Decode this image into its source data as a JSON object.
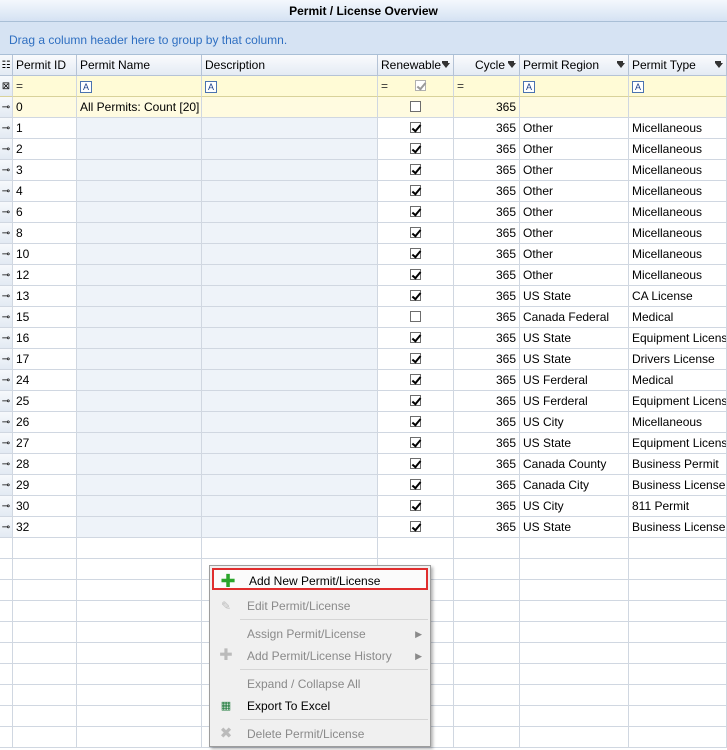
{
  "title": "Permit / License Overview",
  "group_hint": "Drag a column header here to group by that column.",
  "columns": {
    "id": "Permit ID",
    "name": "Permit Name",
    "desc": "Description",
    "renew": "Renewable",
    "cycle": "Cycle",
    "region": "Permit Region",
    "type": "Permit Type"
  },
  "filter": {
    "eq": "=",
    "text_icon": "A"
  },
  "group_row": {
    "id": "0",
    "name": "All Permits: Count [20]",
    "cycle": "365"
  },
  "rows": [
    {
      "id": "1",
      "cycle": "365",
      "region": "Other",
      "type": "Micellaneous",
      "renewable": true
    },
    {
      "id": "2",
      "cycle": "365",
      "region": "Other",
      "type": "Micellaneous",
      "renewable": true
    },
    {
      "id": "3",
      "cycle": "365",
      "region": "Other",
      "type": "Micellaneous",
      "renewable": true
    },
    {
      "id": "4",
      "cycle": "365",
      "region": "Other",
      "type": "Micellaneous",
      "renewable": true
    },
    {
      "id": "6",
      "cycle": "365",
      "region": "Other",
      "type": "Micellaneous",
      "renewable": true
    },
    {
      "id": "8",
      "cycle": "365",
      "region": "Other",
      "type": "Micellaneous",
      "renewable": true
    },
    {
      "id": "10",
      "cycle": "365",
      "region": "Other",
      "type": "Micellaneous",
      "renewable": true
    },
    {
      "id": "12",
      "cycle": "365",
      "region": "Other",
      "type": "Micellaneous",
      "renewable": true
    },
    {
      "id": "13",
      "cycle": "365",
      "region": "US State",
      "type": "CA License",
      "renewable": true
    },
    {
      "id": "15",
      "cycle": "365",
      "region": "Canada Federal",
      "type": "Medical",
      "renewable": false
    },
    {
      "id": "16",
      "cycle": "365",
      "region": "US State",
      "type": "Equipment Licens",
      "renewable": true
    },
    {
      "id": "17",
      "cycle": "365",
      "region": "US State",
      "type": "Drivers License",
      "renewable": true
    },
    {
      "id": "24",
      "cycle": "365",
      "region": "US Ferderal",
      "type": "Medical",
      "renewable": true
    },
    {
      "id": "25",
      "cycle": "365",
      "region": "US Ferderal",
      "type": "Equipment Licens",
      "renewable": true
    },
    {
      "id": "26",
      "cycle": "365",
      "region": "US City",
      "type": "Micellaneous",
      "renewable": true
    },
    {
      "id": "27",
      "cycle": "365",
      "region": "US State",
      "type": "Equipment Licens",
      "renewable": true
    },
    {
      "id": "28",
      "cycle": "365",
      "region": "Canada County",
      "type": "Business Permit",
      "renewable": true
    },
    {
      "id": "29",
      "cycle": "365",
      "region": "Canada City",
      "type": "Business License",
      "renewable": true
    },
    {
      "id": "30",
      "cycle": "365",
      "region": "US City",
      "type": "811 Permit",
      "renewable": true
    },
    {
      "id": "32",
      "cycle": "365",
      "region": "US State",
      "type": "Business License",
      "renewable": true
    }
  ],
  "context_menu": {
    "add": "Add New Permit/License",
    "edit": "Edit Permit/License",
    "assign": "Assign Permit/License",
    "history": "Add Permit/License History",
    "expand": "Expand / Collapse All",
    "export": "Export To Excel",
    "delete": "Delete Permit/License"
  },
  "colors": {
    "highlight_border": "#e02d2d",
    "group_text": "#2f6fc1",
    "add_icon": "#2aa52a"
  }
}
